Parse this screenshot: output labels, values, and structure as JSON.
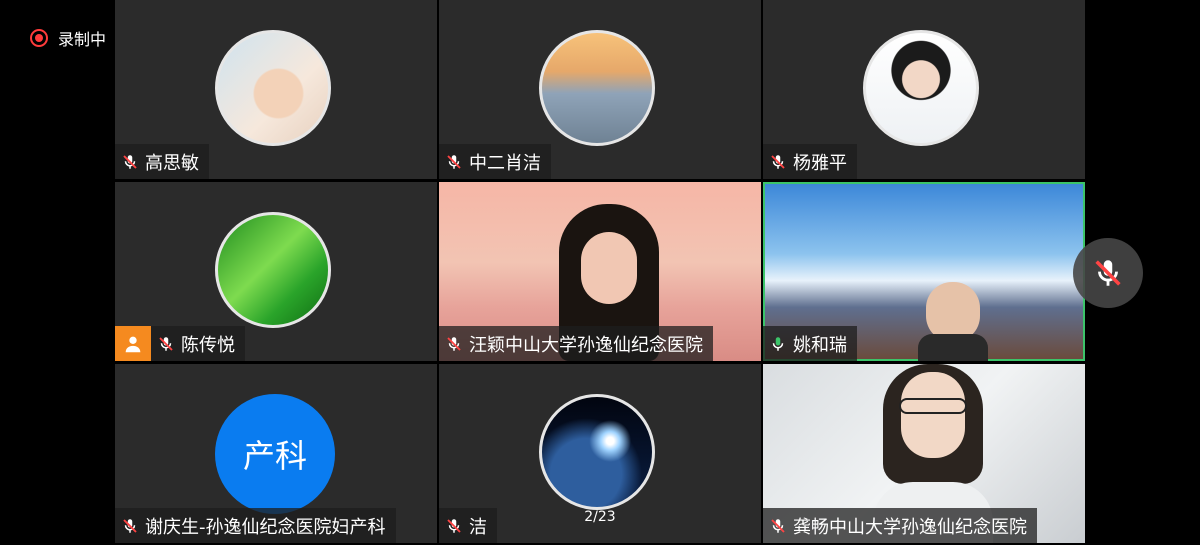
{
  "recording": {
    "label": "录制中",
    "color": "#ff3b3b"
  },
  "tiles": [
    {
      "name": "高思敏",
      "mic": "muted",
      "avatar": "hands-photo"
    },
    {
      "name": "中二肖洁",
      "mic": "muted",
      "avatar": "sunset-photo"
    },
    {
      "name": "杨雅平",
      "mic": "muted",
      "avatar": "doctor-photo"
    },
    {
      "name": "陈传悦",
      "mic": "muted",
      "avatar": "green-abstract",
      "host": true
    },
    {
      "name": "汪颖中山大学孙逸仙纪念医院",
      "mic": "muted",
      "video": "woman-pink-background"
    },
    {
      "name": "姚和瑞",
      "mic": "active",
      "video": "mountain-background",
      "active_speaker": true
    },
    {
      "name": "谢庆生-孙逸仙纪念医院妇产科",
      "mic": "muted",
      "avatar_text": "产科",
      "avatar_color": "#0a7cf0"
    },
    {
      "name": "洁",
      "mic": "muted",
      "avatar": "earth-photo",
      "page_indicator": "2/23"
    },
    {
      "name": "龚畅中山大学孙逸仙纪念医院",
      "mic": "muted",
      "video": "woman-webcam"
    }
  ],
  "colors": {
    "active_border": "#3cc46a",
    "host_badge": "#f58a1f",
    "tile_bg": "#2b2b2b",
    "muted": "#ff4444"
  },
  "floating_mic": {
    "state": "muted",
    "icon": "mic-muted-icon"
  }
}
